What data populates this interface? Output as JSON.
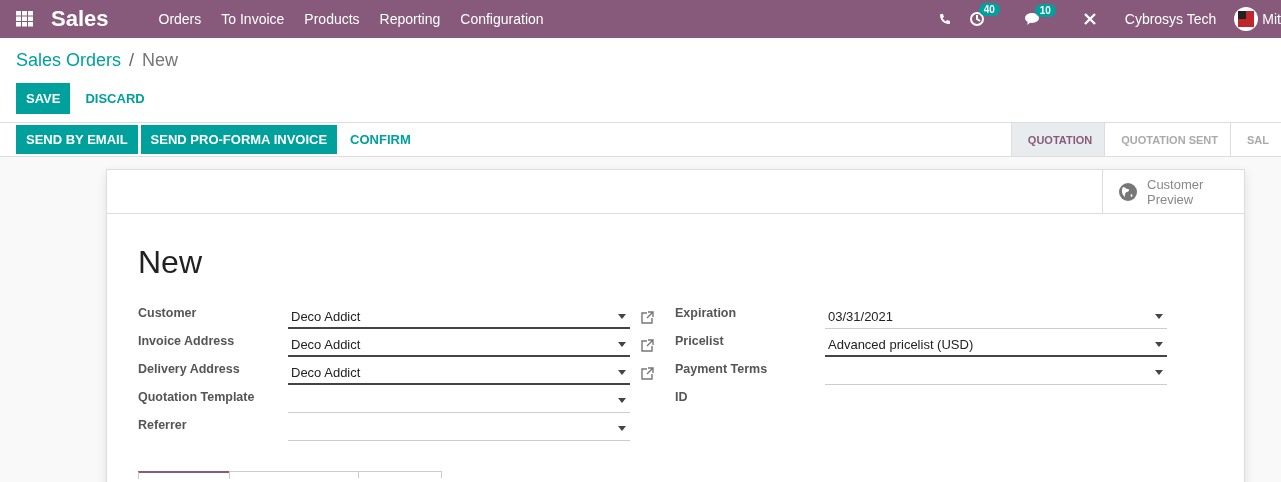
{
  "navbar": {
    "app": "Sales",
    "menu": [
      "Orders",
      "To Invoice",
      "Products",
      "Reporting",
      "Configuration"
    ],
    "activity_count": "40",
    "message_count": "10",
    "company": "Cybrosys Tech",
    "user": "Mit"
  },
  "breadcrumb": {
    "parent": "Sales Orders",
    "separator": "/",
    "current": "New"
  },
  "actions": {
    "save": "SAVE",
    "discard": "DISCARD"
  },
  "header_buttons": [
    {
      "label": "SEND BY EMAIL",
      "primary": true
    },
    {
      "label": "SEND PRO-FORMA INVOICE",
      "primary": true
    },
    {
      "label": "CONFIRM",
      "primary": false
    }
  ],
  "stages": [
    {
      "label": "QUOTATION",
      "selected": true
    },
    {
      "label": "QUOTATION SENT",
      "selected": false
    },
    {
      "label": "SAL",
      "selected": false
    }
  ],
  "smart_button": {
    "label": "Customer Preview"
  },
  "title": "New",
  "left_fields": [
    {
      "label": "Customer",
      "value": "Deco Addict",
      "emphasized": true,
      "external_link": true
    },
    {
      "label": "Invoice Address",
      "value": "Deco Addict",
      "emphasized": true,
      "external_link": true
    },
    {
      "label": "Delivery Address",
      "value": "Deco Addict",
      "emphasized": true,
      "external_link": true
    },
    {
      "label": "Quotation Template",
      "emphasized": false,
      "external_link": false
    },
    {
      "label": "Referrer",
      "emphasized": false,
      "external_link": false
    }
  ],
  "right_fields": [
    {
      "label": "Expiration",
      "value": "03/31/2021",
      "emphasized": false,
      "kind": "dropdown"
    },
    {
      "label": "Pricelist",
      "value": "Advanced pricelist (USD)",
      "emphasized": true,
      "kind": "dropdown"
    },
    {
      "label": "Payment Terms",
      "emphasized": false,
      "kind": "dropdown"
    },
    {
      "label": "ID",
      "kind": "readonly"
    }
  ],
  "notebook_tabs": [
    {
      "selected": true
    },
    {
      "selected": false
    },
    {
      "selected": false
    }
  ]
}
